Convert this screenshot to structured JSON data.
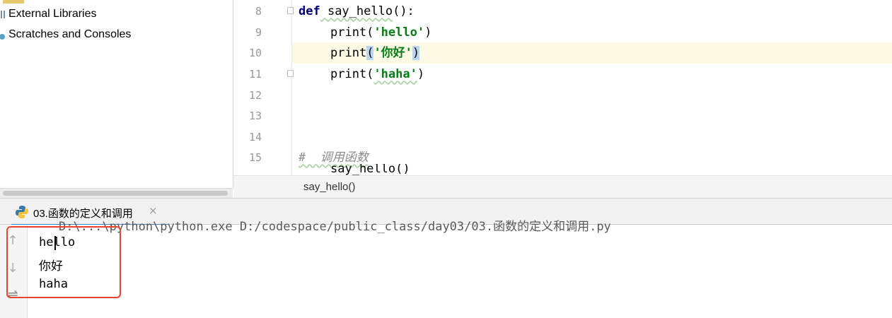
{
  "sidebar": {
    "items": [
      {
        "label": "External Libraries",
        "icon": "library-icon"
      },
      {
        "label": "Scratches and Consoles",
        "icon": "scratches-icon"
      }
    ]
  },
  "editor": {
    "line_numbers": [
      "8",
      "9",
      "10",
      "11",
      "12",
      "13",
      "14",
      "15"
    ],
    "code": {
      "l8_kw": "def",
      "l8_fn": " say_hello",
      "l8_rest": "():",
      "l9_print": "print(",
      "l9_str": "'hello'",
      "l9_close": ")",
      "l10_print": "print",
      "l10_open": "(",
      "l10_str": "'你好'",
      "l10_close": ")",
      "l11_print": "print(",
      "l11_str": "'haha'",
      "l11_close": ")",
      "l15_comment": "#  调用函数",
      "l16_partial": "say_hello()"
    },
    "breadcrumb": "say_hello()"
  },
  "run": {
    "tab_label": "03.函数的定义和调用",
    "close_glyph": "×",
    "command_partial": "D:\\...\\python\\python.exe D:/codespace/public_class/day03/03.函数的定义和调用.py",
    "output": [
      "hello",
      "你好",
      "haha"
    ]
  },
  "colors": {
    "accent": "#4083c9",
    "annotation_box": "#e8452c",
    "current_line": "#fcfae5"
  }
}
